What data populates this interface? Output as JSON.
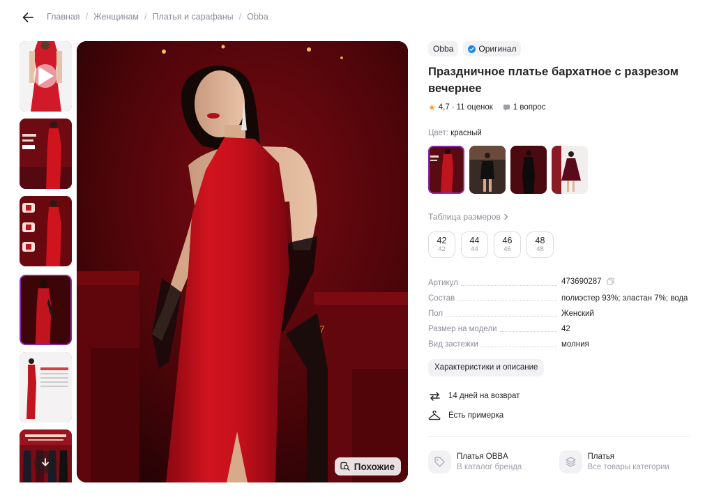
{
  "breadcrumb": {
    "items": [
      "Главная",
      "Женщинам",
      "Платья и сарафаны",
      "Obba"
    ],
    "separator": "/"
  },
  "gallery": {
    "thumbnails": [
      "video-preview",
      "product-photo-2",
      "product-photo-3",
      "product-photo-4",
      "size-chart-photo",
      "banner-photo"
    ],
    "active_index": 3,
    "similar_label": "Похожие"
  },
  "product": {
    "brand": "Obba",
    "original_label": "Оригинал",
    "title": "Праздничное платье бархатное с разрезом вечернее",
    "rating": "4,7",
    "rating_sep": "·",
    "reviews": "11 оценок",
    "questions": "1 вопрос",
    "color_label": "Цвет:",
    "color_value": "красный",
    "swatches": [
      "red-dress",
      "black-strapless-dress",
      "black-halter-dress",
      "burgundy-dress"
    ],
    "active_swatch": 0,
    "size_table_label": "Таблица размеров",
    "sizes": [
      {
        "ru": "42",
        "alt": "42"
      },
      {
        "ru": "44",
        "alt": "44"
      },
      {
        "ru": "46",
        "alt": "46"
      },
      {
        "ru": "48",
        "alt": "48"
      }
    ],
    "specs": [
      {
        "key": "Артикул",
        "value": "473690287"
      },
      {
        "key": "Состав",
        "value": "полиэстер 93%; эластан 7%; вода"
      },
      {
        "key": "Пол",
        "value": "Женский"
      },
      {
        "key": "Размер на модели",
        "value": "42"
      },
      {
        "key": "Вид застежки",
        "value": "молния"
      }
    ],
    "characteristics_button": "Характеристики и описание",
    "features": [
      {
        "icon": "return-arrows-icon",
        "text": "14 дней на возврат"
      },
      {
        "icon": "hanger-icon",
        "text": "Есть примерка"
      }
    ],
    "links": [
      {
        "icon": "tag-icon",
        "title": "Платья OBBA",
        "subtitle": "В каталог бренда"
      },
      {
        "icon": "layers-icon",
        "title": "Платья",
        "subtitle": "Все товары категории"
      }
    ]
  },
  "colors": {
    "accent": "#8b29a8",
    "star": "#ff9b25",
    "verified": "#1e88e5",
    "muted_text": "#8b8b99",
    "dress_red": "#c0141e"
  }
}
